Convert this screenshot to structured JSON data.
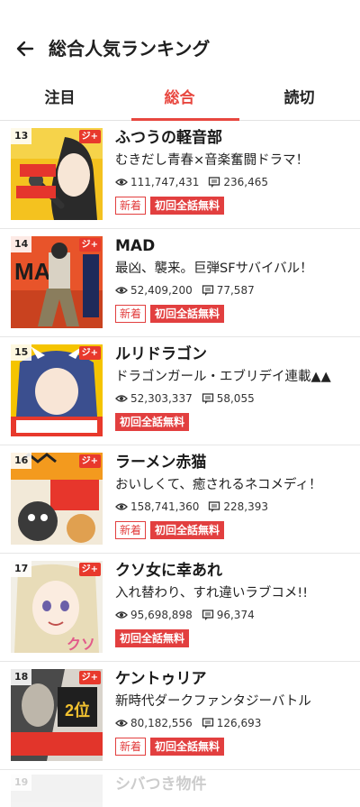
{
  "header": {
    "title": "総合人気ランキング",
    "back_icon": "arrow-left-icon"
  },
  "tabs": [
    {
      "label": "注目"
    },
    {
      "label": "総合",
      "active": true
    },
    {
      "label": "読切"
    }
  ],
  "colors": {
    "accent": "#e8473f"
  },
  "items": [
    {
      "rank": "13",
      "title": "ふつうの軽音部",
      "description": "むきだし青春×音楽奮闘ドラマ！",
      "views": "111,747,431",
      "comments": "236,465",
      "badge_new": "新着",
      "badge_free": "初回全話無料",
      "jump_mark": "ジ+"
    },
    {
      "rank": "14",
      "title": "MAD",
      "description": "最凶、襲来。巨弾SFサバイバル！",
      "views": "52,409,200",
      "comments": "77,587",
      "badge_new": "新着",
      "badge_free": "初回全話無料",
      "jump_mark": "ジ+"
    },
    {
      "rank": "15",
      "title": "ルリドラゴン",
      "description": "ドラゴンガール・エブリデイ連載▲▲",
      "views": "52,303,337",
      "comments": "58,055",
      "badge_free": "初回全話無料",
      "jump_mark": "ジ+"
    },
    {
      "rank": "16",
      "title": "ラーメン赤猫",
      "description": "おいしくて、癒されるネコメディ！",
      "views": "158,741,360",
      "comments": "228,393",
      "badge_new": "新着",
      "badge_free": "初回全話無料",
      "jump_mark": "ジ+"
    },
    {
      "rank": "17",
      "title": "クソ女に幸あれ",
      "description": "入れ替わり、すれ違いラブコメ!!",
      "views": "95,698,898",
      "comments": "96,374",
      "badge_free": "初回全話無料",
      "jump_mark": "ジ+"
    },
    {
      "rank": "18",
      "title": "ケントゥリア",
      "description": "新時代ダークファンタジーバトル",
      "views": "80,182,556",
      "comments": "126,693",
      "badge_new": "新着",
      "badge_free": "初回全話無料",
      "jump_mark": "ジ+"
    }
  ],
  "partial_item": {
    "rank": "19",
    "title": "シバつき物件"
  }
}
